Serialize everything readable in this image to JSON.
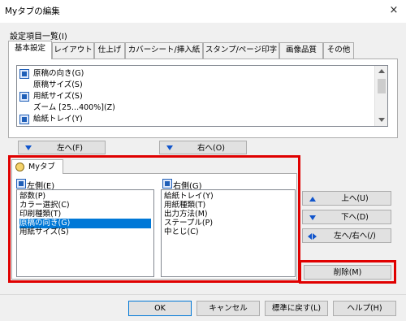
{
  "window": {
    "title": "Myタブの編集",
    "close_icon": "×"
  },
  "section_label": "設定項目一覧(I)",
  "tabs": [
    {
      "label": "基本設定",
      "active": true
    },
    {
      "label": "レイアウト"
    },
    {
      "label": "仕上げ"
    },
    {
      "label": "カバーシート/挿入紙"
    },
    {
      "label": "スタンプ/ページ印字"
    },
    {
      "label": "画像品質"
    },
    {
      "label": "その他"
    }
  ],
  "settings_list": [
    "原稿の向き(G)",
    "原稿サイズ(S)",
    "用紙サイズ(S)",
    "ズーム [25...400%](Z)",
    "給紙トレイ(Y)"
  ],
  "buttons": {
    "to_left": "左へ(F)",
    "to_right": "右へ(O)",
    "up": "上へ(U)",
    "down": "下へ(D)",
    "left_right": "左へ/右へ(/)",
    "delete": "削除(M)",
    "ok": "OK",
    "cancel": "キャンセル",
    "reset": "標準に戻す(L)",
    "help": "ヘルプ(H)"
  },
  "mytab": {
    "tab_label": "Myタブ",
    "left_label": "左側(E)",
    "right_label": "右側(G)",
    "left_items": [
      "部数(P)",
      "カラー選択(C)",
      "印刷種類(T)",
      "原稿の向き(G)",
      "用紙サイズ(S)"
    ],
    "right_items": [
      "給紙トレイ(Y)",
      "用紙種類(T)",
      "出力方法(M)",
      "ステープル(P)",
      "中とじ(C)"
    ]
  },
  "colors": {
    "highlight": "#e00000",
    "selection": "#0078d7",
    "arrow": "#1155cc"
  }
}
